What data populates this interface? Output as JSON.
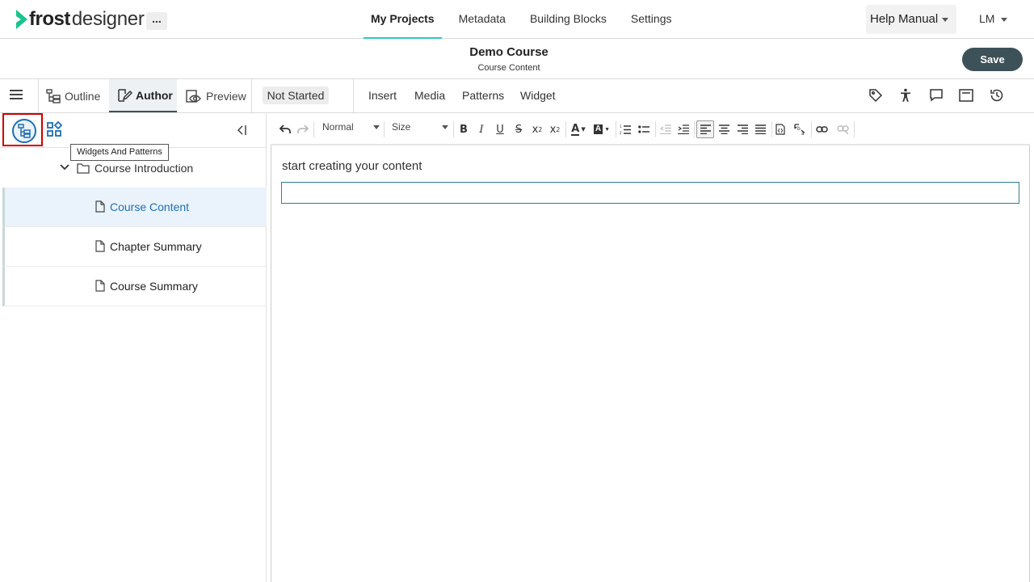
{
  "app": {
    "logo_bold": "frost",
    "logo_light": "designer",
    "more_label": "..."
  },
  "nav": {
    "items": [
      {
        "label": "My Projects",
        "active": true
      },
      {
        "label": "Metadata",
        "active": false
      },
      {
        "label": "Building Blocks",
        "active": false
      },
      {
        "label": "Settings",
        "active": false
      }
    ],
    "help_label": "Help Manual",
    "user_initials": "LM"
  },
  "course": {
    "title": "Demo Course",
    "subtitle": "Course Content",
    "save_label": "Save"
  },
  "modes": {
    "outline_label": "Outline",
    "author_label": "Author",
    "preview_label": "Preview",
    "status_label": "Not Started"
  },
  "menu": {
    "insert": "Insert",
    "media": "Media",
    "patterns": "Patterns",
    "widget": "Widget"
  },
  "right_icons": [
    "tag-icon",
    "accessibility-icon",
    "comment-icon",
    "notes-icon",
    "history-icon"
  ],
  "panel": {
    "tooltip": "Widgets And Patterns",
    "folder_label": "Course Introduction",
    "pages": [
      {
        "label": "Course Content",
        "selected": true
      },
      {
        "label": "Chapter Summary",
        "selected": false
      },
      {
        "label": "Course Summary",
        "selected": false
      }
    ]
  },
  "editor": {
    "format_value": "Normal",
    "size_value": "Size",
    "placeholder": "start creating your content"
  },
  "colors": {
    "accent": "#2fc7c2",
    "save_bg": "#3d5159",
    "link_blue": "#1f6fb3",
    "highlight_red": "#d00000",
    "logo_green": "#19c38c"
  }
}
